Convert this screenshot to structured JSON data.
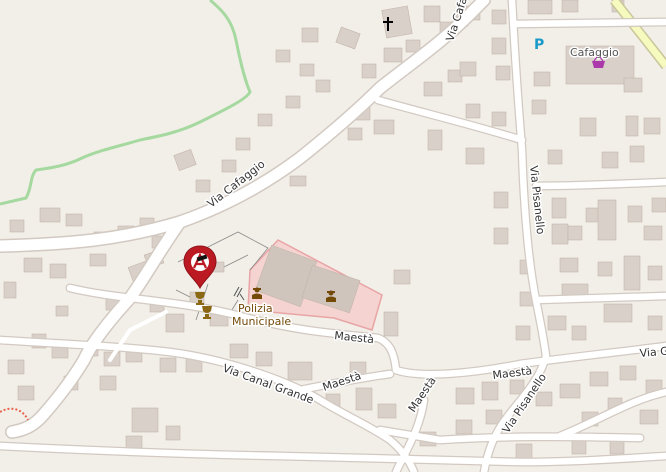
{
  "map": {
    "streets": [
      {
        "id": "via-cafaggio-main",
        "name": "Via Cafaggio"
      },
      {
        "id": "via-cafaggio-north",
        "name": "Via Cafa"
      },
      {
        "id": "via-pisanello-north",
        "name": "Via Pisanello"
      },
      {
        "id": "via-pisanello-south",
        "name": "Via Pisanello"
      },
      {
        "id": "maesta-1",
        "name": "Maestà"
      },
      {
        "id": "maesta-2",
        "name": "Maestà"
      },
      {
        "id": "maesta-3",
        "name": "Maestà"
      },
      {
        "id": "maesta-4",
        "name": "Maestà"
      },
      {
        "id": "via-canal-grande",
        "name": "Via Canal Grande"
      },
      {
        "id": "via-gi",
        "name": "Via Gi"
      }
    ],
    "places": {
      "polizia": {
        "line1": "Polizia",
        "line2": "Municipale"
      },
      "cafaggio": "Cafaggio"
    },
    "symbols": {
      "parking": "P",
      "church": "church-icon",
      "shop": "shopping-basket-icon",
      "police": "police-icon",
      "marker": "location-pin-icon",
      "trophy": "trophy-icon"
    },
    "colors": {
      "land": "#f2efe9",
      "road": "#ffffff",
      "building": "#d9d0c9",
      "boundary": "#a6d9a0",
      "police_area": "#f5d3d1",
      "marker": "#bb1a22",
      "parking": "#1a9ac8",
      "primary_road": "#f7fabf"
    }
  }
}
